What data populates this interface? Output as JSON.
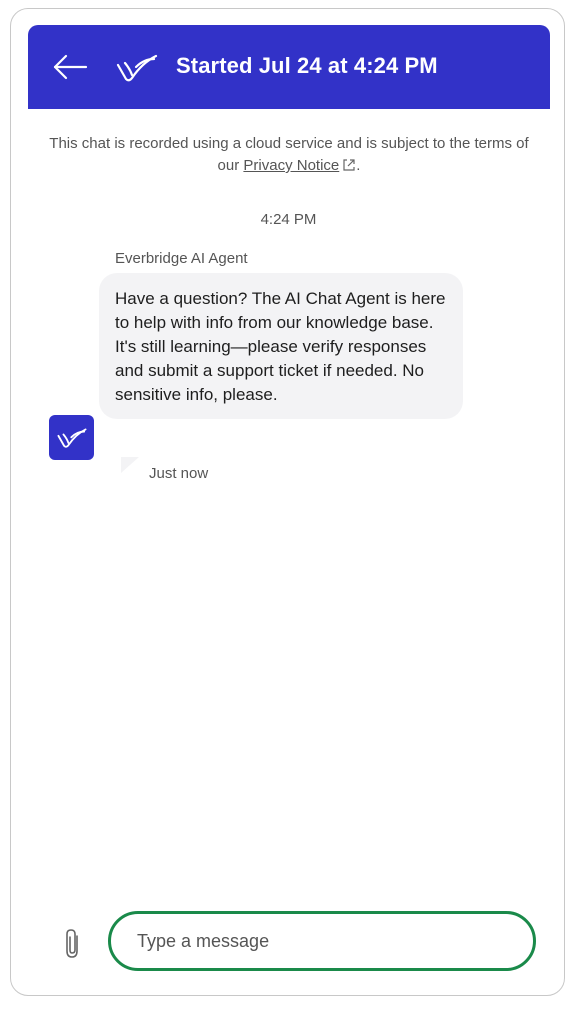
{
  "header": {
    "title": "Started Jul 24 at 4:24 PM",
    "back_icon": "arrow-left-icon",
    "logo_icon": "everbridge-logo-icon",
    "background": "#3232c8"
  },
  "notice": {
    "text_before": "This chat is recorded using a cloud service and is subject to the terms of our ",
    "link_label": "Privacy Notice",
    "text_after": ".",
    "link_icon": "external-link-icon"
  },
  "conversation": {
    "timestamp": "4:24 PM",
    "messages": [
      {
        "sender": "Everbridge AI Agent",
        "text": "Have a question? The AI Chat Agent is here to help with info from our knowledge base. It's still learning—please verify responses and submit a support ticket if needed. No sensitive info, please.",
        "time": "Just now",
        "avatar_icon": "everbridge-logo-icon"
      }
    ]
  },
  "composer": {
    "attach_icon": "paperclip-icon",
    "placeholder": "Type a message",
    "value": "",
    "focus_color": "#1a8a4a"
  }
}
